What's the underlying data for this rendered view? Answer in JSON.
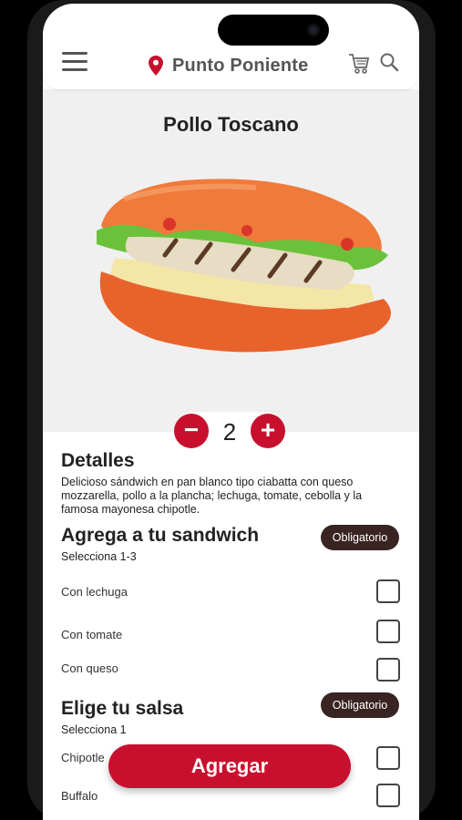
{
  "header": {
    "location": "Punto Poniente"
  },
  "product": {
    "title": "Pollo Toscano",
    "quantity": "2",
    "details_heading": "Detalles",
    "description": "Delicioso sándwich en pan blanco tipo ciabatta con queso mozzarella, pollo a la plancha; lechuga, tomate, cebolla y la famosa mayonesa chipotle."
  },
  "addons": {
    "heading": "Agrega a tu sandwich",
    "subtitle": "Selecciona 1-3",
    "badge": "Obligatorio",
    "options": [
      "Con lechuga",
      "Con tomate",
      "Con queso"
    ]
  },
  "sauce": {
    "heading": "Elige tu salsa",
    "subtitle": "Selecciona 1",
    "badge": "Obligatorio",
    "options": [
      "Chipotle",
      "Buffalo"
    ]
  },
  "actions": {
    "add_label": "Agregar",
    "minus": "−",
    "plus": "+"
  },
  "colors": {
    "accent": "#c8102e",
    "badge": "#3a2323"
  }
}
